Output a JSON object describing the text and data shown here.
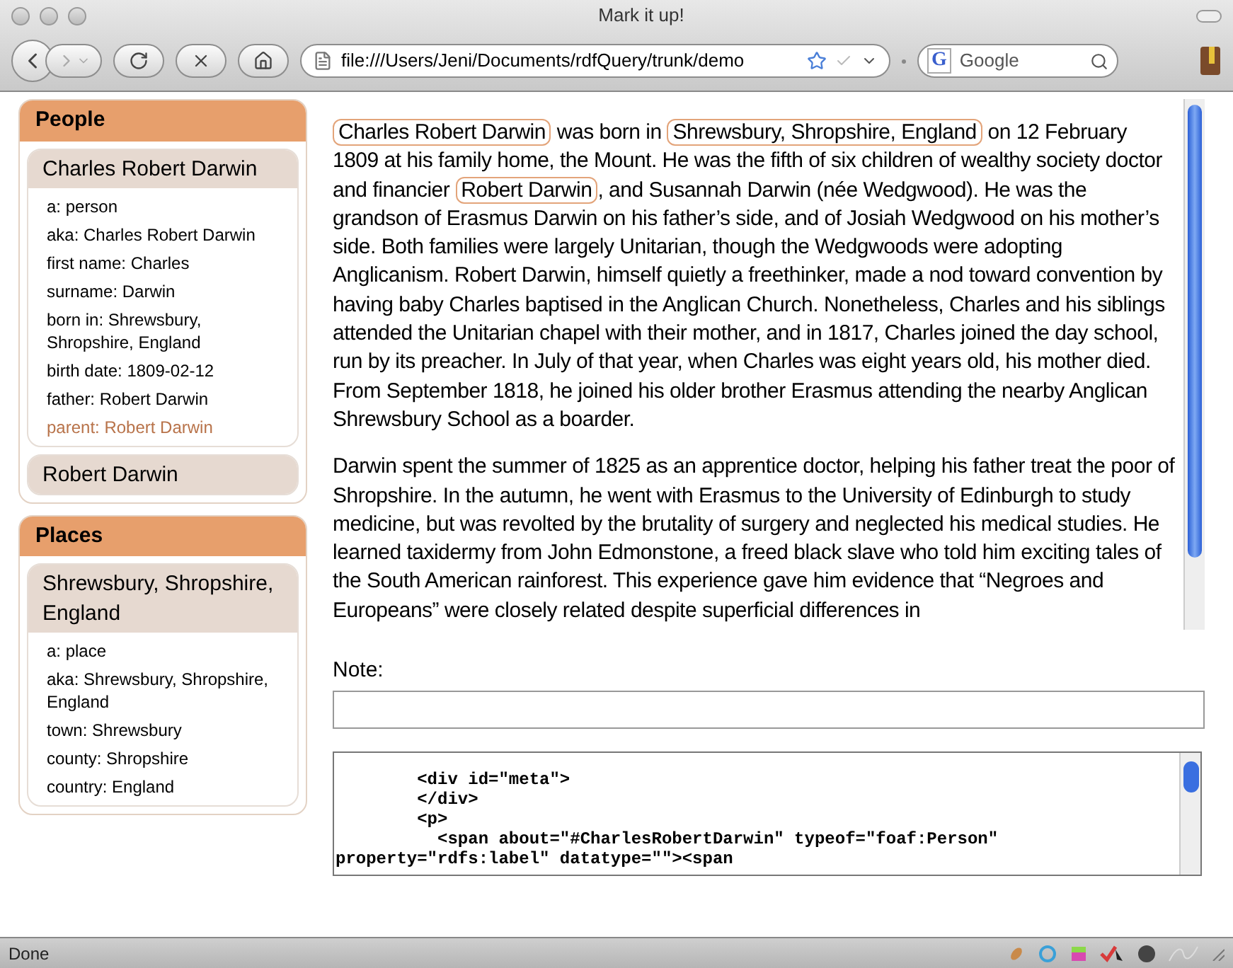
{
  "window": {
    "title": "Mark it up!"
  },
  "toolbar": {
    "url": "file:///Users/Jeni/Documents/rdfQuery/trunk/demo",
    "search_placeholder": "Google",
    "search_engine_letter": "G"
  },
  "sidebar": [
    {
      "title": "People",
      "items": [
        {
          "name": "Charles Robert Darwin",
          "expanded": true,
          "properties": [
            {
              "text": "a: person",
              "highlighted": false
            },
            {
              "text": "aka: Charles Robert Darwin",
              "highlighted": false
            },
            {
              "text": "first name: Charles",
              "highlighted": false
            },
            {
              "text": "surname: Darwin",
              "highlighted": false
            },
            {
              "text": "born in: Shrewsbury, Shropshire, England",
              "highlighted": false
            },
            {
              "text": "birth date: 1809-02-12",
              "highlighted": false
            },
            {
              "text": "father: Robert Darwin",
              "highlighted": false
            },
            {
              "text": "parent: Robert Darwin",
              "highlighted": true
            }
          ]
        },
        {
          "name": "Robert Darwin",
          "expanded": false
        }
      ]
    },
    {
      "title": "Places",
      "items": [
        {
          "name": "Shrewsbury, Shropshire, England",
          "expanded": true,
          "properties": [
            {
              "text": "a: place",
              "highlighted": false
            },
            {
              "text": "aka: Shrewsbury, Shropshire, England",
              "highlighted": false
            },
            {
              "text": "town: Shrewsbury",
              "highlighted": false
            },
            {
              "text": "county: Shropshire",
              "highlighted": false
            },
            {
              "text": "country: England",
              "highlighted": false
            }
          ]
        }
      ]
    }
  ],
  "article": [
    [
      {
        "text": "Charles Robert Darwin",
        "marked": true
      },
      {
        "text": " was born in ",
        "marked": false
      },
      {
        "text": "Shrewsbury, Shropshire, England",
        "marked": true
      },
      {
        "text": " on 12 February 1809 at his family home, the Mount. He was the fifth of six children of wealthy society doctor and financier ",
        "marked": false
      },
      {
        "text": "Robert Darwin",
        "marked": true
      },
      {
        "text": ", and Susannah Darwin (née Wedgwood). He was the grandson of Erasmus Darwin on his father’s side, and of Josiah Wedgwood on his mother’s side. Both families were largely Unitarian, though the Wedgwoods were adopting Anglicanism. Robert Darwin, himself quietly a freethinker, made a nod toward convention by having baby Charles baptised in the Anglican Church. Nonetheless, Charles and his siblings attended the Unitarian chapel with their mother, and in 1817, Charles joined the day school, run by its preacher. In July of that year, when Charles was eight years old, his mother died. From September 1818, he joined his older brother Erasmus attending the nearby Anglican Shrewsbury School as a boarder.",
        "marked": false
      }
    ],
    [
      {
        "text": "Darwin spent the summer of 1825 as an apprentice doctor, helping his father treat the poor of Shropshire. In the autumn, he went with Erasmus to the University of Edinburgh to study medicine, but was revolted by the brutality of surgery and neglected his medical studies. He learned taxidermy from John Edmonstone, a freed black slave who told him exciting tales of the South American rainforest. This experience gave him evidence that “Negroes and Europeans” were closely related despite superficial differences in",
        "marked": false
      }
    ]
  ],
  "note": {
    "label": "Note:"
  },
  "code_lines": [
    "        <div id=\"meta\">",
    "        </div>",
    "        <p>",
    "          <span about=\"#CharlesRobertDarwin\" typeof=\"foaf:Person\" property=\"rdfs:label\" datatype=\"\"><span"
  ],
  "status_bar": {
    "text": "Done"
  }
}
